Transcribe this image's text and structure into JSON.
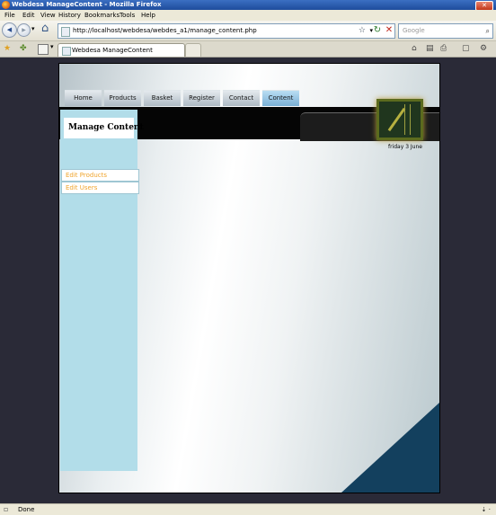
{
  "window": {
    "title": "Webdesa ManageContent - Mozilla Firefox",
    "close_glyph": "✕"
  },
  "menu": [
    "File",
    "Edit",
    "View",
    "History",
    "Bookmarks",
    "Tools",
    "Help"
  ],
  "nav": {
    "back_glyph": "◀",
    "forward_glyph": "▶",
    "dropdown_glyph": "▾",
    "home_glyph": "⌂",
    "url": "http://localhost/webdesa/webdes_a1/manage_content.php",
    "bookmark_star": "☆",
    "reload_glyph": "↻",
    "stop_glyph": "✕",
    "search_placeholder": "Google",
    "search_glyph": "⌕"
  },
  "tabs": {
    "active_label": "Webdesa ManageContent"
  },
  "toolbar_icons": [
    "star-icon",
    "bookmark-icon",
    "page-icon",
    "print-icon",
    "page-menu-icon",
    "tools-icon"
  ],
  "site": {
    "nav_items": [
      "Home",
      "Products",
      "Basket",
      "Register",
      "Contact",
      "Content"
    ],
    "sidebar_title": "Manage Content",
    "links": [
      "Edit Products",
      "Edit Users"
    ],
    "date": "friday 3 June"
  },
  "status": {
    "text": "Done",
    "right": "⇣ ·"
  },
  "colors": {
    "page_bg": "#2a2a37",
    "sidebar": "#b2dde9",
    "link": "#f0a42c",
    "corner": "#13405e",
    "active_tab": "#6a9cc7"
  }
}
